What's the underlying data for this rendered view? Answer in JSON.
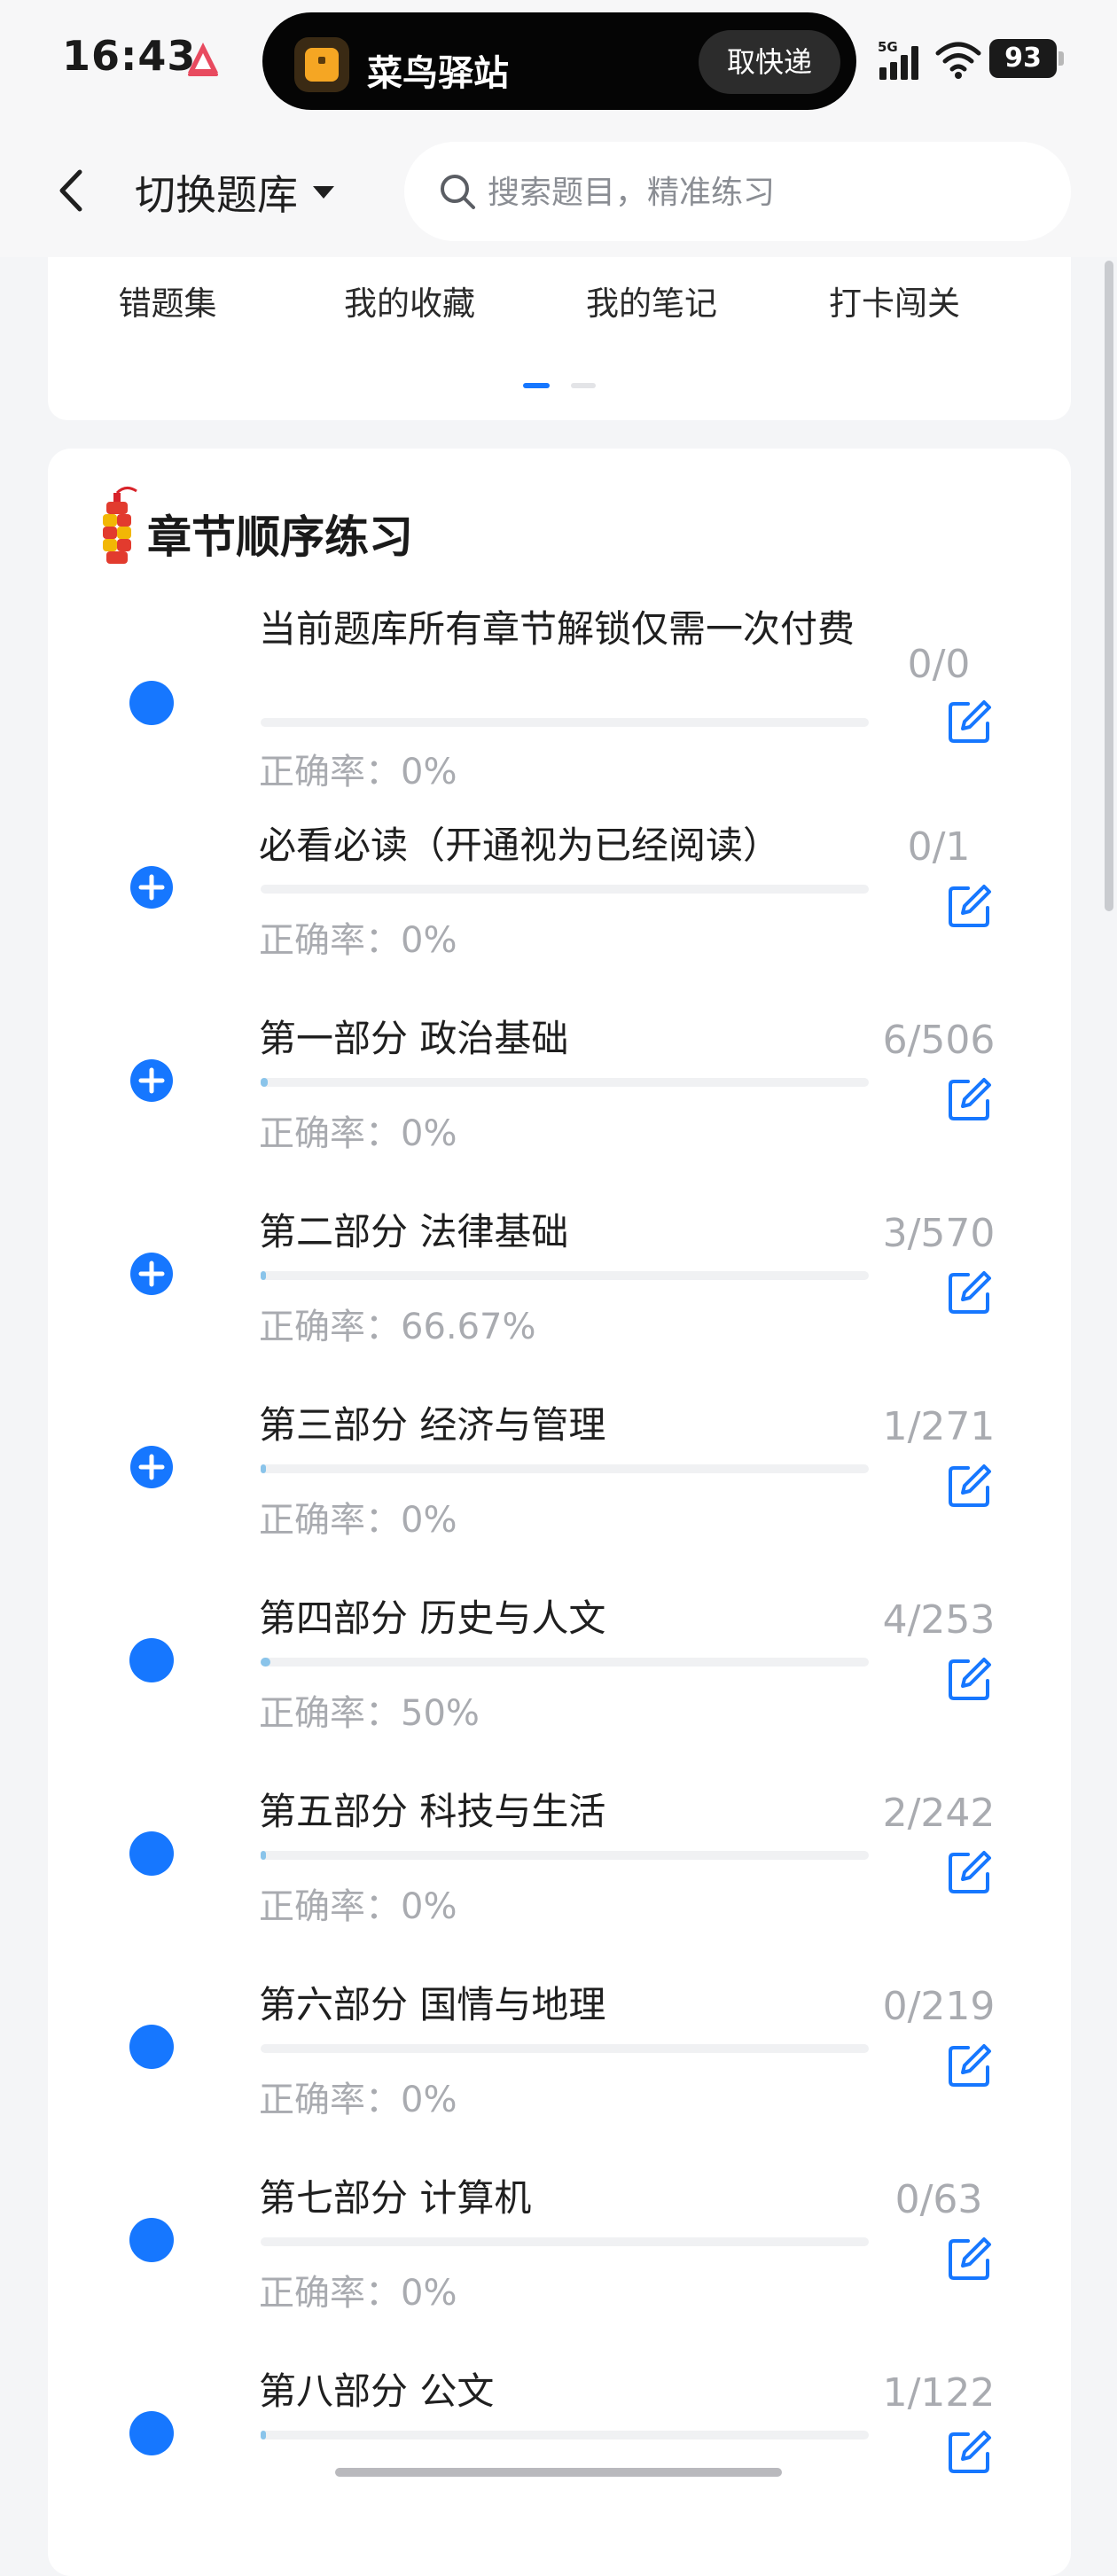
{
  "status_bar": {
    "time": "16:43",
    "island_title": "菜鸟驿站",
    "island_button": "取快递",
    "network": "5G",
    "battery": "93"
  },
  "header": {
    "switch_label": "切换题库",
    "search_placeholder": "搜索题目，精准练习"
  },
  "shortcuts": {
    "items": [
      "错题集",
      "我的收藏",
      "我的笔记",
      "打卡闯关"
    ],
    "page_index": 0,
    "page_count": 2
  },
  "section": {
    "title": "章节顺序练习"
  },
  "chapters": [
    {
      "name": "当前题库所有章节解锁仅需一次付费",
      "accuracy": "正确率：0%",
      "count": "0/0",
      "icon": "dot",
      "progress": 0
    },
    {
      "name": "必看必读（开通视为已经阅读）",
      "accuracy": "正确率：0%",
      "count": "0/1",
      "icon": "expand-plus",
      "progress": 0
    },
    {
      "name": "第一部分 政治基础",
      "accuracy": "正确率：0%",
      "count": "6/506",
      "icon": "expand-plus",
      "progress": 0.012
    },
    {
      "name": "第二部分 法律基础",
      "accuracy": "正确率：66.67%",
      "count": "3/570",
      "icon": "expand-plus",
      "progress": 0.005
    },
    {
      "name": "第三部分 经济与管理",
      "accuracy": "正确率：0%",
      "count": "1/271",
      "icon": "expand-plus",
      "progress": 0.004
    },
    {
      "name": "第四部分 历史与人文",
      "accuracy": "正确率：50%",
      "count": "4/253",
      "icon": "dot",
      "progress": 0.016
    },
    {
      "name": "第五部分 科技与生活",
      "accuracy": "正确率：0%",
      "count": "2/242",
      "icon": "dot",
      "progress": 0.008
    },
    {
      "name": "第六部分 国情与地理",
      "accuracy": "正确率：0%",
      "count": "0/219",
      "icon": "dot",
      "progress": 0
    },
    {
      "name": "第七部分 计算机",
      "accuracy": "正确率：0%",
      "count": "0/63",
      "icon": "dot",
      "progress": 0
    },
    {
      "name": "第八部分 公文",
      "accuracy": "",
      "count": "1/122",
      "icon": "dot",
      "progress": 0.008
    }
  ],
  "colors": {
    "accent": "#1677ff",
    "progress": "#8ac4ea",
    "muted_text": "#a9abb0",
    "page_bg": "#f4f5f7"
  }
}
